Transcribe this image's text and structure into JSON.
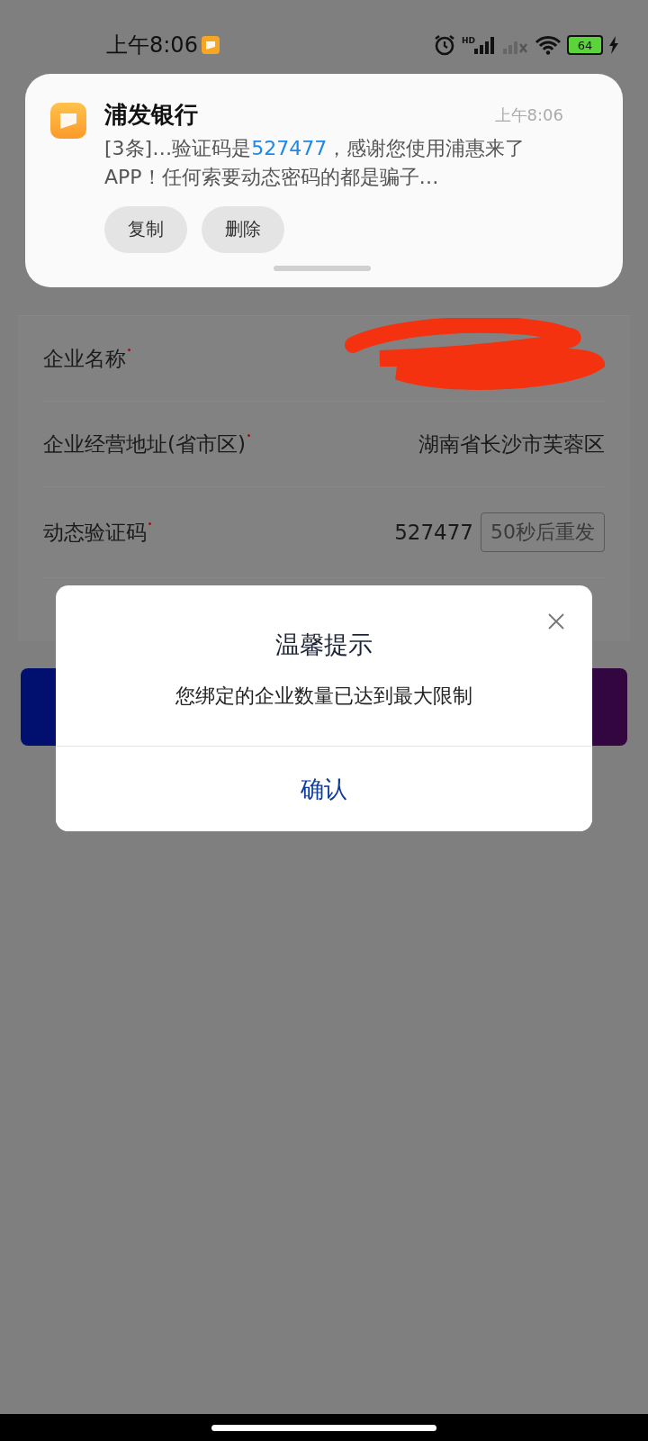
{
  "status_bar": {
    "time": "上午8:06",
    "network_label": "HD",
    "battery": "64",
    "charging": true
  },
  "notification": {
    "app": "浦发银行",
    "time": "上午8:06",
    "message_before": "[3条]…验证码是",
    "code": "527477",
    "message_after": "，感谢您使用浦惠来了APP！任何索要动态密码的都是骗子…",
    "actions": [
      "复制",
      "删除"
    ]
  },
  "form": {
    "rows": [
      {
        "label": "企业名称",
        "required": true,
        "redacted": true
      },
      {
        "label": "企业经营地址(省市区)",
        "required": true,
        "value": "湖南省长沙市芙蓉区"
      },
      {
        "label": "动态验证码",
        "required": true,
        "value": "527477",
        "resend": "50秒后重发"
      }
    ]
  },
  "dialog": {
    "title": "温馨提示",
    "message": "您绑定的企业数量已达到最大限制",
    "confirm": "确认"
  }
}
